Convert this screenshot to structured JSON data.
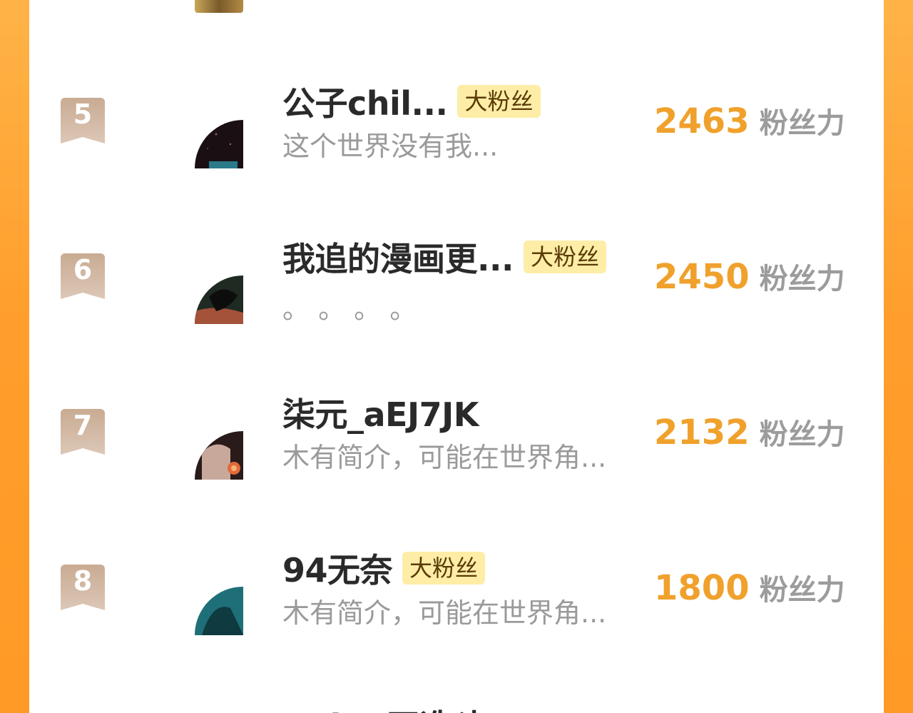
{
  "rows": [
    {
      "rank": "5",
      "name": "公子chil...",
      "tag": "大粉丝",
      "bio": "这个世界没有我...",
      "score": "2463",
      "unit": "粉丝力"
    },
    {
      "rank": "6",
      "name": "我追的漫画更...",
      "tag": "大粉丝",
      "bio": "。 。 。 。",
      "score": "2450",
      "unit": "粉丝力"
    },
    {
      "rank": "7",
      "name": "柒元_aEJ7JK",
      "tag": "",
      "bio": "木有简介，可能在世界角...",
      "score": "2132",
      "unit": "粉丝力"
    },
    {
      "rank": "8",
      "name": "94无奈",
      "tag": "大粉丝",
      "bio": "木有简介，可能在世界角...",
      "score": "1800",
      "unit": "粉丝力"
    }
  ],
  "next_row": {
    "name": "Raine巫造斗"
  },
  "colors": {
    "accent": "#f0a12c",
    "tag_bg": "#fdeda6",
    "badge": "#c9ab92",
    "background": "#ff9e2c"
  }
}
